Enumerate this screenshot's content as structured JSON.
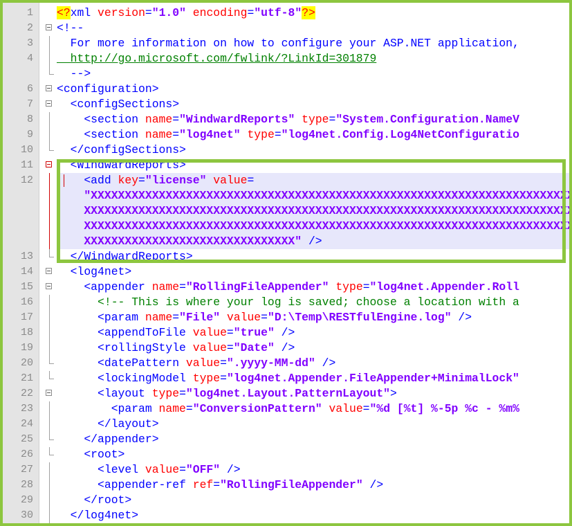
{
  "editor": {
    "lines": [
      {
        "n": "1",
        "parts": [
          [
            "pi",
            "<?"
          ],
          [
            "t",
            "xml "
          ],
          [
            "a",
            "version"
          ],
          [
            "t",
            "="
          ],
          [
            "v",
            "\"1.0\""
          ],
          [
            "t",
            " "
          ],
          [
            "a",
            "encoding"
          ],
          [
            "t",
            "="
          ],
          [
            "v",
            "\"utf-8\""
          ],
          [
            "pi",
            "?>"
          ]
        ]
      },
      {
        "n": "2",
        "parts": [
          [
            "t",
            "<!--"
          ]
        ]
      },
      {
        "n": "3",
        "parts": [
          [
            "t",
            "  For more information on how to configure your ASP.NET application, "
          ]
        ]
      },
      {
        "n": "4",
        "parts": [
          [
            "ch",
            "  http://go.microsoft.com/fwlink/?LinkId=301879"
          ]
        ]
      },
      {
        "n": "",
        "parts": [
          [
            "t",
            "  -->"
          ]
        ]
      },
      {
        "n": "6",
        "parts": [
          [
            "t",
            "<configuration>"
          ]
        ]
      },
      {
        "n": "7",
        "parts": [
          [
            "t",
            "  <configSections>"
          ]
        ]
      },
      {
        "n": "8",
        "parts": [
          [
            "t",
            "    <section "
          ],
          [
            "a",
            "name"
          ],
          [
            "t",
            "="
          ],
          [
            "v",
            "\"WindwardReports\""
          ],
          [
            "t",
            " "
          ],
          [
            "a",
            "type"
          ],
          [
            "t",
            "="
          ],
          [
            "v",
            "\"System.Configuration.NameV"
          ]
        ]
      },
      {
        "n": "9",
        "parts": [
          [
            "t",
            "    <section "
          ],
          [
            "a",
            "name"
          ],
          [
            "t",
            "="
          ],
          [
            "v",
            "\"log4net\""
          ],
          [
            "t",
            " "
          ],
          [
            "a",
            "type"
          ],
          [
            "t",
            "="
          ],
          [
            "v",
            "\"log4net.Config.Log4NetConfiguratio"
          ]
        ]
      },
      {
        "n": "10",
        "parts": [
          [
            "t",
            "  </configSections>"
          ]
        ]
      },
      {
        "n": "11",
        "parts": [
          [
            "t",
            "  <WindwardReports>"
          ]
        ]
      },
      {
        "n": "12",
        "parts": [
          [
            "t",
            "    <add "
          ],
          [
            "a",
            "key"
          ],
          [
            "t",
            "="
          ],
          [
            "v",
            "\"license\""
          ],
          [
            "t",
            " "
          ],
          [
            "a",
            "value"
          ],
          [
            "t",
            "="
          ]
        ]
      },
      {
        "n": "",
        "parts": [
          [
            "v",
            "    \"XXXXXXXXXXXXXXXXXXXXXXXXXXXXXXXXXXXXXXXXXXXXXXXXXXXXXXXXXXXXXXXXXXXXXXXXXXXX"
          ]
        ]
      },
      {
        "n": "",
        "parts": [
          [
            "v",
            "    XXXXXXXXXXXXXXXXXXXXXXXXXXXXXXXXXXXXXXXXXXXXXXXXXXXXXXXXXXXXXXXXXXXXXXXXXXXXXX"
          ]
        ]
      },
      {
        "n": "",
        "parts": [
          [
            "v",
            "    XXXXXXXXXXXXXXXXXXXXXXXXXXXXXXXXXXXXXXXXXXXXXXXXXXXXXXXXXXXXXXXXXXXXXXXXXXXXXX"
          ]
        ]
      },
      {
        "n": "",
        "parts": [
          [
            "v",
            "    XXXXXXXXXXXXXXXXXXXXXXXXXXXXXXX\""
          ],
          [
            "t",
            " />"
          ]
        ]
      },
      {
        "n": "13",
        "parts": [
          [
            "t",
            "  </WindwardReports>"
          ]
        ]
      },
      {
        "n": "14",
        "parts": [
          [
            "t",
            "  <log4net>"
          ]
        ]
      },
      {
        "n": "15",
        "parts": [
          [
            "t",
            "    <appender "
          ],
          [
            "a",
            "name"
          ],
          [
            "t",
            "="
          ],
          [
            "v",
            "\"RollingFileAppender\""
          ],
          [
            "t",
            " "
          ],
          [
            "a",
            "type"
          ],
          [
            "t",
            "="
          ],
          [
            "v",
            "\"log4net.Appender.Roll"
          ]
        ]
      },
      {
        "n": "16",
        "parts": [
          [
            "c",
            "      <!-- This is where your log is saved; choose a location with a"
          ]
        ]
      },
      {
        "n": "17",
        "parts": [
          [
            "t",
            "      <param "
          ],
          [
            "a",
            "name"
          ],
          [
            "t",
            "="
          ],
          [
            "v",
            "\"File\""
          ],
          [
            "t",
            " "
          ],
          [
            "a",
            "value"
          ],
          [
            "t",
            "="
          ],
          [
            "v",
            "\"D:\\Temp\\RESTfulEngine.log\""
          ],
          [
            "t",
            " />"
          ]
        ]
      },
      {
        "n": "18",
        "parts": [
          [
            "t",
            "      <appendToFile "
          ],
          [
            "a",
            "value"
          ],
          [
            "t",
            "="
          ],
          [
            "v",
            "\"true\""
          ],
          [
            "t",
            " />"
          ]
        ]
      },
      {
        "n": "19",
        "parts": [
          [
            "t",
            "      <rollingStyle "
          ],
          [
            "a",
            "value"
          ],
          [
            "t",
            "="
          ],
          [
            "v",
            "\"Date\""
          ],
          [
            "t",
            " />"
          ]
        ]
      },
      {
        "n": "20",
        "parts": [
          [
            "t",
            "      <datePattern "
          ],
          [
            "a",
            "value"
          ],
          [
            "t",
            "="
          ],
          [
            "v",
            "\".yyyy-MM-dd\""
          ],
          [
            "t",
            " />"
          ]
        ]
      },
      {
        "n": "21",
        "parts": [
          [
            "t",
            "      <lockingModel "
          ],
          [
            "a",
            "type"
          ],
          [
            "t",
            "="
          ],
          [
            "v",
            "\"log4net.Appender.FileAppender+MinimalLock\""
          ]
        ]
      },
      {
        "n": "22",
        "parts": [
          [
            "t",
            "      <layout "
          ],
          [
            "a",
            "type"
          ],
          [
            "t",
            "="
          ],
          [
            "v",
            "\"log4net.Layout.PatternLayout\""
          ],
          [
            "t",
            ">"
          ]
        ]
      },
      {
        "n": "23",
        "parts": [
          [
            "t",
            "        <param "
          ],
          [
            "a",
            "name"
          ],
          [
            "t",
            "="
          ],
          [
            "v",
            "\"ConversionPattern\""
          ],
          [
            "t",
            " "
          ],
          [
            "a",
            "value"
          ],
          [
            "t",
            "="
          ],
          [
            "v",
            "\"%d [%t] %-5p %c - %m%"
          ]
        ]
      },
      {
        "n": "24",
        "parts": [
          [
            "t",
            "      </layout>"
          ]
        ]
      },
      {
        "n": "25",
        "parts": [
          [
            "t",
            "    </appender>"
          ]
        ]
      },
      {
        "n": "26",
        "parts": [
          [
            "t",
            "    <root>"
          ]
        ]
      },
      {
        "n": "27",
        "parts": [
          [
            "t",
            "      <level "
          ],
          [
            "a",
            "value"
          ],
          [
            "t",
            "="
          ],
          [
            "v",
            "\"OFF\""
          ],
          [
            "t",
            " />"
          ]
        ]
      },
      {
        "n": "28",
        "parts": [
          [
            "t",
            "      <appender-ref "
          ],
          [
            "a",
            "ref"
          ],
          [
            "t",
            "="
          ],
          [
            "v",
            "\"RollingFileAppender\""
          ],
          [
            "t",
            " />"
          ]
        ]
      },
      {
        "n": "29",
        "parts": [
          [
            "t",
            "    </root>"
          ]
        ]
      },
      {
        "n": "30",
        "parts": [
          [
            "t",
            "  </log4net>"
          ]
        ]
      }
    ]
  },
  "colors": {
    "accent_border": "#8dc63f",
    "tag": "#0000ff",
    "attribute": "#ff0000",
    "value": "#8000ff",
    "comment": "#008000",
    "selection": "#e7e7fb"
  }
}
